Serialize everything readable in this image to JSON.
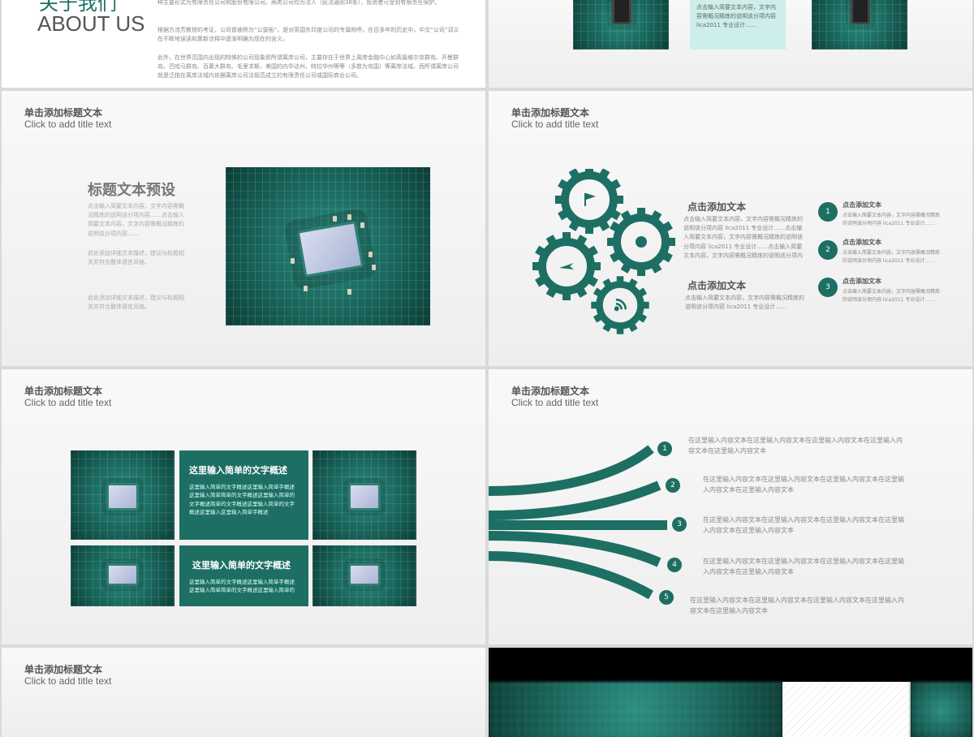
{
  "colors": {
    "accent": "#1e6f63",
    "light_teal": "#cdeeea"
  },
  "slide_about": {
    "title_cn": "关于我们",
    "title_en": "ABOUT US",
    "para1": "种主要形式为有限责任公司和股份有限公司。两类公司均为法人（民法通则36条），投资者可受到有限责任保护。",
    "para2": "根据方流芳教授的考证，公司曾被称为“公拔衙”，是对英国东印度公司的专属称呼。在百多年的历史中，中文“公司”词义在不断地误读和重新诠释中逐渐明确为现在的含义。",
    "para3": "此外，在世界范围内出现的特殊的公司现象即所谓离岸公司，主要存在于世界上离岸金融中心如英属维尔京群岛、开曼群岛、巴哈马群岛、百慕大群岛、毛里求斯、美国的内华达州、特拉华州等等（多数为岛国）等离岸法域。而所谓离岸公司就是泛指在离岸法域内依据离岸公司法规范成立的有限责任公司或国际商业公司。"
  },
  "slide_chips_top": {
    "text": "点击输入简要文本内容，文字内容需概况精炼的说明该分项内容 lica2011 专业设计……"
  },
  "slide_preset": {
    "title": "单击添加标题文本",
    "subtitle": "Click to add title text",
    "heading": "标题文本预设",
    "p1": "点击输入简要文本内容，文字内容需概况精炼的说明该分项内容……点击输入简要文本内容，文字内容需概况精炼的说明该分项内容……",
    "p2": "此处添加详细文本描述，建议与标题相关并符合整体语言风格。",
    "p3": "此处添加详细文本描述，建议与标题相关并符合整体语言风格。"
  },
  "slide_gears": {
    "title": "单击添加标题文本",
    "subtitle": "Click to add title text",
    "block1_title": "点击添加文本",
    "block1_text": "点击输入简要文本内容，文字内容需概况精炼的说明该分项内容 lica2011 专业设计……点击输入简要文本内容，文字内容需概况精炼的说明该分项内容 lica2011 专业设计……点击输入简要文本内容，文字内容需概况精炼的说明该分项内容 lica2011 专业设计……",
    "block2_title": "点击添加文本",
    "block2_text": "点击输入简要文本内容，文字内容需概况精炼的说明该分项内容 lica2011 专业设计……",
    "items": [
      {
        "num": "1",
        "title": "点击添加文本",
        "text": "点击输入简要文本内容，文字内容需概况精炼的说明该分项内容 lica2011 专业设计……"
      },
      {
        "num": "2",
        "title": "点击添加文本",
        "text": "点击输入简要文本内容，文字内容需概况精炼的说明该分项内容 lica2011 专业设计……"
      },
      {
        "num": "3",
        "title": "点击添加文本",
        "text": "点击输入简要文本内容，文字内容需概况精炼的说明该分项内容 lica2011 专业设计……"
      }
    ],
    "gear_icons": [
      "flag-icon",
      "globe-icon",
      "plane-icon",
      "wifi-icon"
    ]
  },
  "slide_grid": {
    "title": "单击添加标题文本",
    "subtitle": "Click to add title text",
    "box1_title": "这里输入简单的文字概述",
    "box1_text": "这里输入简单的文字概述这里输入简单字概述这里输入简单简单的文字概述这里输入简单的文字概述简单的文字概述这里输入简单的文字概述这里输入这里输入简单字概述",
    "box2_title": "这里输入简单的文字概述",
    "box2_text": "这里输入简单的文字概述这里输入简单字概述这里输入简单简单的文字概述这里输入简单的"
  },
  "slide_lines": {
    "title": "单击添加标题文本",
    "subtitle": "Click to add title text",
    "items": [
      {
        "num": "1",
        "text": "在这里输入内容文本在这里输入内容文本在这里输入内容文本在这里输入内容文本在这里输入内容文本"
      },
      {
        "num": "2",
        "text": "在这里输入内容文本在这里输入内容文本在这里输入内容文本在这里输入内容文本在这里输入内容文本"
      },
      {
        "num": "3",
        "text": "在这里输入内容文本在这里输入内容文本在这里输入内容文本在这里输入内容文本在这里输入内容文本"
      },
      {
        "num": "4",
        "text": "在这里输入内容文本在这里输入内容文本在这里输入内容文本在这里输入内容文本在这里输入内容文本"
      },
      {
        "num": "5",
        "text": "在这里输入内容文本在这里输入内容文本在这里输入内容文本在这里输入内容文本在这里输入内容文本"
      }
    ]
  },
  "slide_bottom_left": {
    "title": "单击添加标题文本",
    "subtitle": "Click to add title text"
  }
}
